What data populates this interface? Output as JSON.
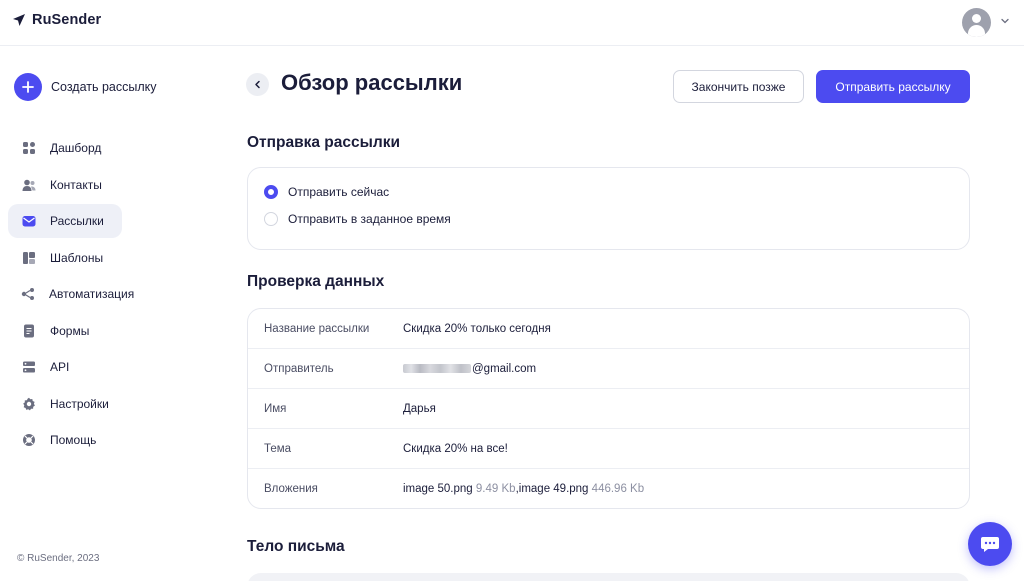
{
  "app": {
    "logo_text": "RuSender"
  },
  "sidebar": {
    "create_label": "Создать рассылку",
    "items": [
      {
        "label": "Дашборд",
        "icon": "dashboard-icon"
      },
      {
        "label": "Контакты",
        "icon": "contacts-icon"
      },
      {
        "label": "Рассылки",
        "icon": "mail-icon",
        "active": true
      },
      {
        "label": "Шаблоны",
        "icon": "templates-icon"
      },
      {
        "label": "Автоматизация",
        "icon": "automation-icon"
      },
      {
        "label": "Формы",
        "icon": "forms-icon"
      },
      {
        "label": "API",
        "icon": "api-icon"
      },
      {
        "label": "Настройки",
        "icon": "gear-icon"
      },
      {
        "label": "Помощь",
        "icon": "help-icon"
      }
    ],
    "copyright": "© RuSender, 2023"
  },
  "header": {
    "title": "Обзор рассылки",
    "later_label": "Закончить позже",
    "send_label": "Отправить рассылку"
  },
  "sending": {
    "title": "Отправка рассылки",
    "options": [
      {
        "label": "Отправить сейчас",
        "checked": true
      },
      {
        "label": "Отправить в заданное время",
        "checked": false
      }
    ]
  },
  "review": {
    "title": "Проверка данных",
    "rows": {
      "name": {
        "key": "Название рассылки",
        "value": "Скидка 20% только сегодня"
      },
      "sender": {
        "key": "Отправитель",
        "value": "@gmail.com"
      },
      "from_name": {
        "key": "Имя",
        "value": "Дарья"
      },
      "subject": {
        "key": "Тема",
        "value": "Скидка 20% на все!"
      },
      "attachments": {
        "key": "Вложения",
        "file1": "image 50.png",
        "size1": "9.49 Kb",
        "sep": ",",
        "file2": "image 49.png",
        "size2": "446.96 Kb"
      }
    }
  },
  "body_section": {
    "title": "Тело письма"
  },
  "colors": {
    "accent": "#4c4bf0",
    "text": "#1b1d3a",
    "muted": "#8d90a2",
    "border": "#e5e7ee"
  }
}
